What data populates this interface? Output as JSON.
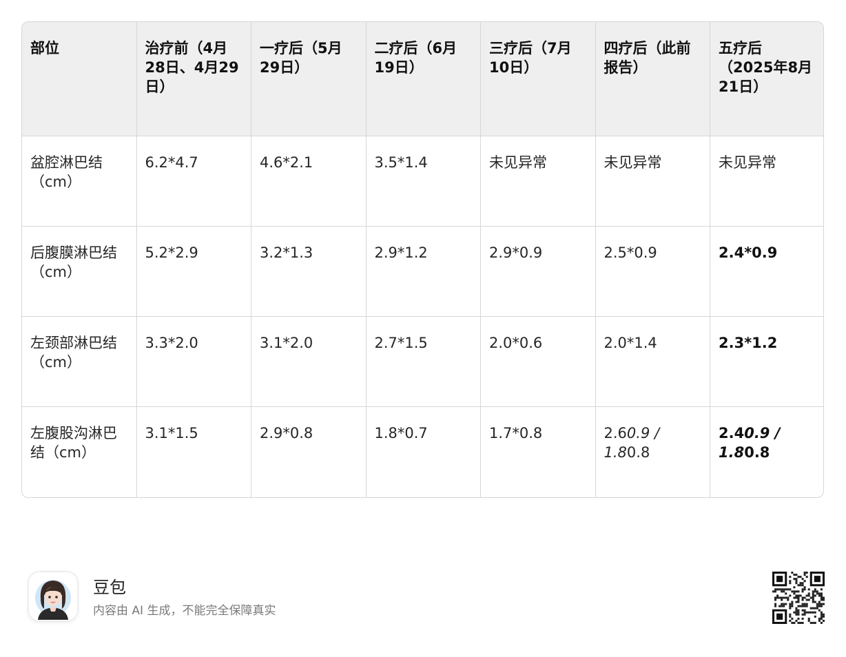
{
  "table": {
    "headers": [
      "部位",
      "治疗前（4月28日、4月29日）",
      "一疗后（5月29日）",
      "二疗后（6月19日）",
      "三疗后（7月10日）",
      "四疗后（此前报告）",
      "五疗后（2025年8月21日）"
    ],
    "rows": [
      {
        "site": "盆腔淋巴结（cm）",
        "values": [
          "6.2*4.7",
          "4.6*2.1",
          "3.5*1.4",
          "未见异常",
          "未见异常",
          "未见异常"
        ]
      },
      {
        "site": "后腹膜淋巴结（cm）",
        "values": [
          "5.2*2.9",
          "3.2*1.3",
          "2.9*1.2",
          "2.9*0.9",
          "2.5*0.9",
          "2.4*0.9"
        ]
      },
      {
        "site": "左颈部淋巴结（cm）",
        "values": [
          "3.3*2.0",
          "3.1*2.0",
          "2.7*1.5",
          "2.0*0.6",
          "2.0*1.4",
          "2.3*1.2"
        ]
      },
      {
        "site": "左腹股沟淋巴结（cm）",
        "values": [
          "3.1*1.5",
          "2.9*0.8",
          "1.8*0.7",
          "1.7*0.8"
        ],
        "mixed": [
          {
            "a": "2.6",
            "b": "0.9 / 1.8",
            "c": "0.8"
          },
          {
            "a": "2.4",
            "b": "0.9 / 1.8",
            "c": "0.8"
          }
        ]
      }
    ]
  },
  "footer": {
    "brand": "豆包",
    "disclaimer": "内容由 AI 生成，不能完全保障真实",
    "avatar_icon": "avatar-icon",
    "qr_icon": "qr-code-icon"
  }
}
